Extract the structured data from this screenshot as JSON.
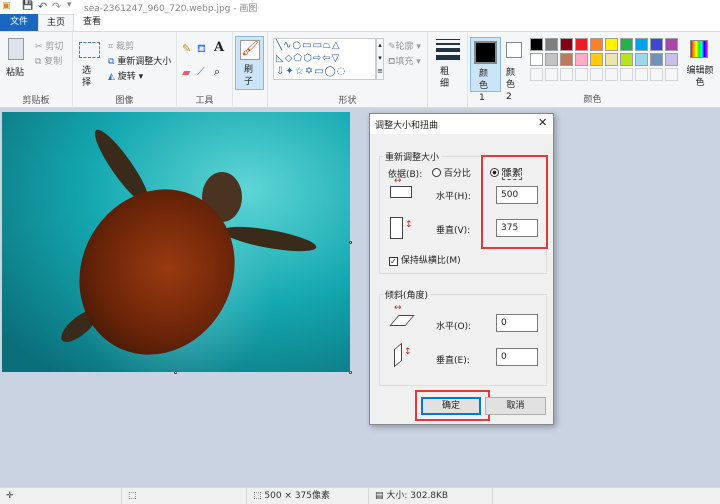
{
  "window": {
    "title": "sea-2361247_960_720.webp.jpg - 画图"
  },
  "tabs": [
    {
      "label": "文件"
    },
    {
      "label": "主页"
    },
    {
      "label": "查看"
    }
  ],
  "ribbon": {
    "clipboard": {
      "paste": "粘贴",
      "cut": "剪切",
      "copy": "复制",
      "label": "剪贴板"
    },
    "image": {
      "select": "选择",
      "crop": "裁剪",
      "resize": "重新调整大小",
      "rotate": "旋转",
      "label": "图像"
    },
    "tools": {
      "label": "工具"
    },
    "brush": {
      "label": "刷子"
    },
    "shapes": {
      "outline": "轮廓",
      "fill": "填充",
      "label": "形状"
    },
    "size": {
      "label": "粗细"
    },
    "color1": "颜色 1",
    "color2": "颜色 2",
    "edit_colors": "编辑颜色",
    "colors_label": "颜色",
    "palette": [
      "#000000",
      "#7f7f7f",
      "#880015",
      "#ed1c24",
      "#ff7f27",
      "#fff200",
      "#22b14c",
      "#00a2e8",
      "#3f48cc",
      "#a349a4",
      "#ffffff",
      "#c3c3c3",
      "#b97a57",
      "#ffaec9",
      "#ffc90e",
      "#efe4b0",
      "#b5e61d",
      "#99d9ea",
      "#7092be",
      "#c8bfe7"
    ]
  },
  "dialog": {
    "title": "调整大小和扭曲",
    "resize_group": "重新调整大小",
    "by_label": "依据(B):",
    "percent": "百分比",
    "pixels": "像素",
    "pixels_selected": true,
    "horizontal_label": "水平(H):",
    "horizontal_value": "500",
    "vertical_label": "垂直(V):",
    "vertical_value": "375",
    "keep_aspect": "保持纵横比(M)",
    "keep_aspect_checked": true,
    "skew_group": "倾斜(角度)",
    "skew_h_label": "水平(O):",
    "skew_h_value": "0",
    "skew_v_label": "垂直(E):",
    "skew_v_value": "0",
    "ok": "确定",
    "cancel": "取消"
  },
  "status": {
    "dimensions": "500 × 375像素",
    "size": "大小: 302.8KB"
  }
}
